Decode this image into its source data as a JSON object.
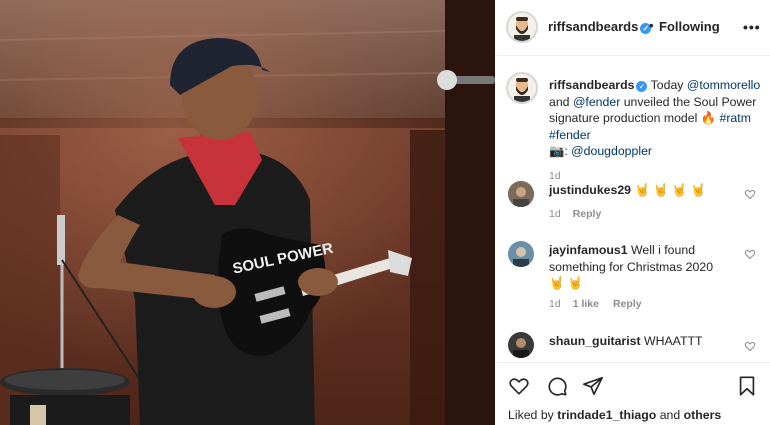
{
  "post": {
    "username": "riffsandbeards",
    "verified_mark": "✓",
    "separator": "•",
    "following_label": "Following",
    "more_label": "•••"
  },
  "caption": {
    "username": "riffsandbeards",
    "text_1": " Today ",
    "mention_1": "@tommorello",
    "text_2": " and ",
    "mention_2": "@fender",
    "text_3": " unveiled the Soul Power signature production model ",
    "emoji_fire": "🔥",
    "hashtag_1": "#ratm",
    "hashtag_2": "#fender",
    "camera_emoji": "📷",
    "credit_prefix": ": ",
    "mention_3": "@dougdoppler",
    "time": "1d"
  },
  "comments": [
    {
      "username": "justindukes29",
      "text": "🤘 🤘 🤘 🤘",
      "time": "1d",
      "likes": "",
      "reply_label": "Reply",
      "avatar_icon": "user-avatar"
    },
    {
      "username": "jayinfamous1",
      "text": "Well i found something for Christmas 2020🤘 🤘",
      "time": "1d",
      "likes": "1 like",
      "reply_label": "Reply",
      "avatar_icon": "user-avatar"
    },
    {
      "username": "shaun_guitarist",
      "text": "WHAATTT",
      "time": "",
      "likes": "",
      "reply_label": "",
      "avatar_icon": "user-avatar"
    }
  ],
  "footer": {
    "liked_by_prefix": "Liked by ",
    "liked_by_user": "trindade1_thiago",
    "and_label": " and ",
    "others_label": "others"
  },
  "photo": {
    "guitar_text": "SOUL POWER"
  },
  "icons": [
    "heart-icon",
    "comment-icon",
    "share-icon",
    "bookmark-icon",
    "more-icon",
    "verified-badge-icon"
  ],
  "colors": {
    "link": "#00376b",
    "verified": "#3897f0",
    "meta": "#8e8e8e",
    "text": "#262626"
  }
}
